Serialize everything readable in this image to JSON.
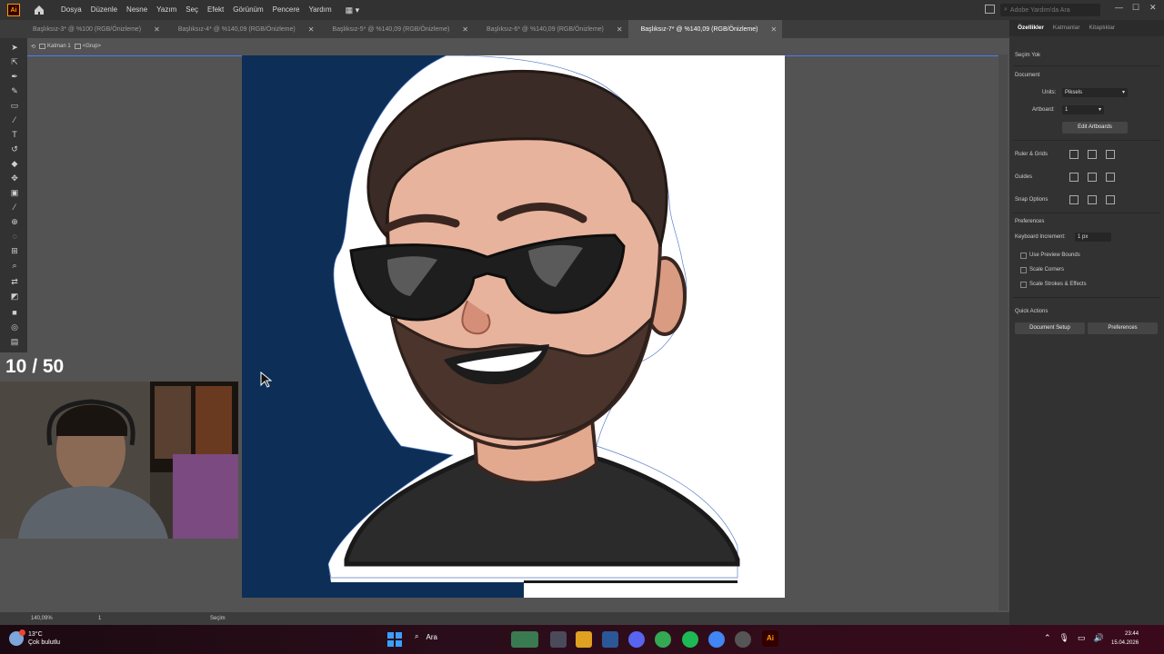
{
  "app": {
    "logo_text": "Ai",
    "menu": [
      "Dosya",
      "Düzenle",
      "Nesne",
      "Yazım",
      "Seç",
      "Efekt",
      "Görünüm",
      "Pencere",
      "Yardım"
    ],
    "search_placeholder": "Adobe Yardım'da Ara"
  },
  "tabs": [
    {
      "label": "Başlıksız-3* @ %100 (RGB/Önizleme)",
      "active": false
    },
    {
      "label": "Başlıksız-4* @ %140,09 (RGB/Önizleme)",
      "active": false
    },
    {
      "label": "Başlıksız-5* @ %140,09 (RGB/Önizleme)",
      "active": false
    },
    {
      "label": "Başlıksız-6* @ %140,09 (RGB/Önizleme)",
      "active": false
    },
    {
      "label": "Başlıksız-7* @ %140,09 (RGB/Önizleme)",
      "active": true
    }
  ],
  "breadcrumb": {
    "layer": "Katman 1",
    "group": "<Grup>"
  },
  "overlay": {
    "counter": "10 / 50"
  },
  "status": {
    "zoom": "140,09%",
    "page": "1",
    "tool": "Seçim"
  },
  "panel": {
    "tabs": [
      "Özellikler",
      "Katmanlar",
      "Kitaplıklar"
    ],
    "no_selection": "Seçim Yok",
    "document_heading": "Document",
    "units_label": "Units:",
    "units_value": "Piksels",
    "artboard_label": "Artboard:",
    "artboard_value": "1",
    "edit_artboards": "Edit Artboards",
    "rulers_grids": "Ruler & Grids",
    "guides": "Guides",
    "snap_options": "Snap Options",
    "preferences_heading": "Preferences",
    "keyboard_increment_label": "Keyboard Increment:",
    "keyboard_increment_value": "1 px",
    "use_preview_bounds": "Use Preview Bounds",
    "scale_corners": "Scale Corners",
    "scale_strokes": "Scale Strokes & Effects",
    "quick_actions": "Quick Actions",
    "document_setup": "Document Setup",
    "preferences_btn": "Preferences"
  },
  "taskbar": {
    "temperature": "13°C",
    "weather_desc": "Çok bulutlu",
    "search": "Ara",
    "time": "23:44",
    "date": "15.04.2026"
  },
  "colors": {
    "artboard_bg": "#0d2f57",
    "accent": "#ff9a00",
    "selection": "#4a7bff"
  }
}
